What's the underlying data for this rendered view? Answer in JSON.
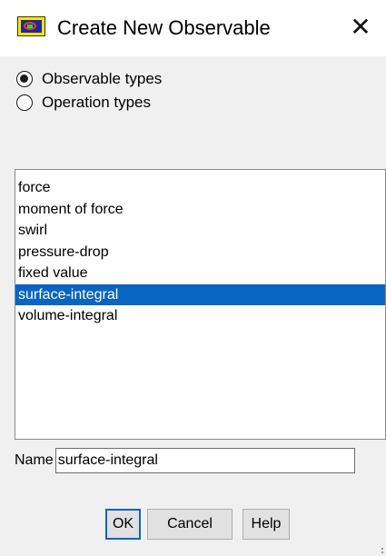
{
  "window": {
    "title": "Create New Observable",
    "close_glyph": "✕",
    "icon": "ansys-fluent-app-icon"
  },
  "radio_group": {
    "options": [
      {
        "label": "Observable types",
        "checked": true
      },
      {
        "label": "Operation types",
        "checked": false
      }
    ]
  },
  "list": {
    "items": [
      "force",
      "moment of force",
      "swirl",
      "pressure-drop",
      "fixed value",
      "surface-integral",
      "volume-integral"
    ],
    "selected": "surface-integral"
  },
  "name_field": {
    "label": "Name",
    "value": "surface-integral"
  },
  "buttons": {
    "ok": "OK",
    "cancel": "Cancel",
    "help": "Help"
  },
  "colors": {
    "selection": "#0a64c2",
    "dialog_bg": "#f0f0f0",
    "focus_border": "#0a64c2"
  }
}
